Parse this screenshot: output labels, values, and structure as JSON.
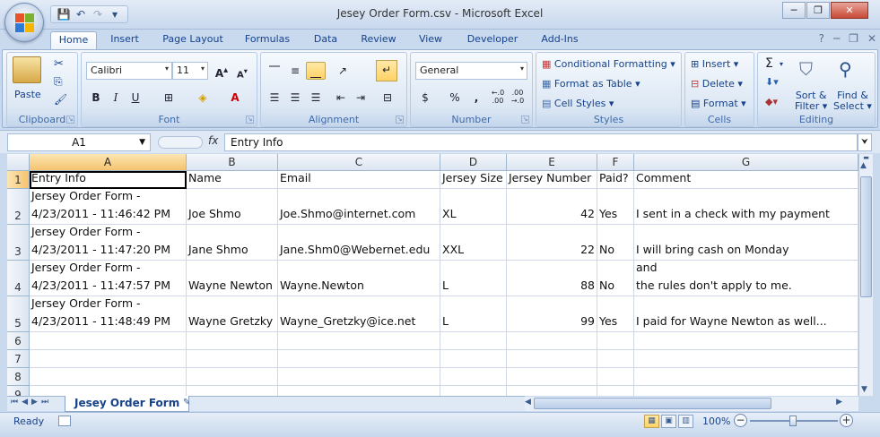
{
  "window": {
    "title": "Jesey Order Form.csv - Microsoft Excel",
    "minimize": "─",
    "restore": "❐",
    "close": "✕"
  },
  "qat": {
    "save": "💾",
    "undo": "↶",
    "redo": "↷",
    "more": "▾"
  },
  "tabs": [
    "Home",
    "Insert",
    "Page Layout",
    "Formulas",
    "Data",
    "Review",
    "View",
    "Developer",
    "Add-Ins"
  ],
  "ribbon": {
    "clipboard": {
      "label": "Clipboard",
      "paste": "Paste"
    },
    "font": {
      "label": "Font",
      "name": "Calibri",
      "size": "11",
      "bold": "B",
      "italic": "I",
      "underline": "U"
    },
    "alignment": {
      "label": "Alignment"
    },
    "number": {
      "label": "Number",
      "format": "General",
      "currency": "$",
      "percent": "%",
      "comma": ",",
      "inc_decimal": "←.0\n.00",
      "dec_decimal": ".00\n→.0"
    },
    "styles": {
      "label": "Styles",
      "conditional": "Conditional Formatting",
      "format_table": "Format as Table",
      "cell_styles": "Cell Styles"
    },
    "cells": {
      "label": "Cells",
      "insert": "Insert",
      "delete": "Delete",
      "format": "Format"
    },
    "editing": {
      "label": "Editing",
      "sigma": "Σ",
      "sort_filter": "Sort &",
      "sort_filter2": "Filter",
      "find_select": "Find &",
      "find_select2": "Select"
    }
  },
  "formula_bar": {
    "name_box": "A1",
    "fx": "fx",
    "content": "Entry Info"
  },
  "columns": [
    "A",
    "B",
    "C",
    "D",
    "E",
    "F",
    "G"
  ],
  "rows": [
    {
      "num": "1",
      "cells": [
        "Entry Info",
        "Name",
        "Email",
        "Jersey Size",
        "Jersey Number",
        "Paid?",
        "Comment"
      ]
    },
    {
      "num": "2",
      "cells": [
        "Jersey Order Form -\n4/23/2011 - 11:46:42 PM",
        "Joe Shmo",
        "Joe.Shmo@internet.com",
        "XL",
        "42",
        "Yes",
        "I sent in a check with my payment"
      ]
    },
    {
      "num": "3",
      "cells": [
        "Jersey Order Form -\n4/23/2011 - 11:47:20 PM",
        "Jane Shmo",
        "Jane.Shm0@Webernet.edu",
        "XXL",
        "22",
        "No",
        "I will bring cash on Monday"
      ]
    },
    {
      "num": "4",
      "cells": [
        "Jersey Order Form -\n4/23/2011 - 11:47:57 PM",
        "Wayne Newton",
        "Wayne.Newton",
        "L",
        "88",
        "No",
        "I don't plan on paying. I am special and\nthe rules don't apply to me."
      ]
    },
    {
      "num": "5",
      "cells": [
        "Jersey Order Form -\n4/23/2011 - 11:48:49 PM",
        "Wayne Gretzky",
        "Wayne_Gretzky@ice.net",
        "L",
        "99",
        "Yes",
        "I paid for Wayne Newton as well..."
      ]
    },
    {
      "num": "6",
      "cells": [
        "",
        "",
        "",
        "",
        "",
        "",
        ""
      ]
    },
    {
      "num": "7",
      "cells": [
        "",
        "",
        "",
        "",
        "",
        "",
        ""
      ]
    },
    {
      "num": "8",
      "cells": [
        "",
        "",
        "",
        "",
        "",
        "",
        ""
      ]
    },
    {
      "num": "9",
      "cells": [
        "",
        "",
        "",
        "",
        "",
        "",
        ""
      ]
    }
  ],
  "sheet_tab": "Jesey Order Form",
  "status": {
    "ready": "Ready",
    "zoom": "100%",
    "zoom_minus": "−",
    "zoom_plus": "+"
  }
}
